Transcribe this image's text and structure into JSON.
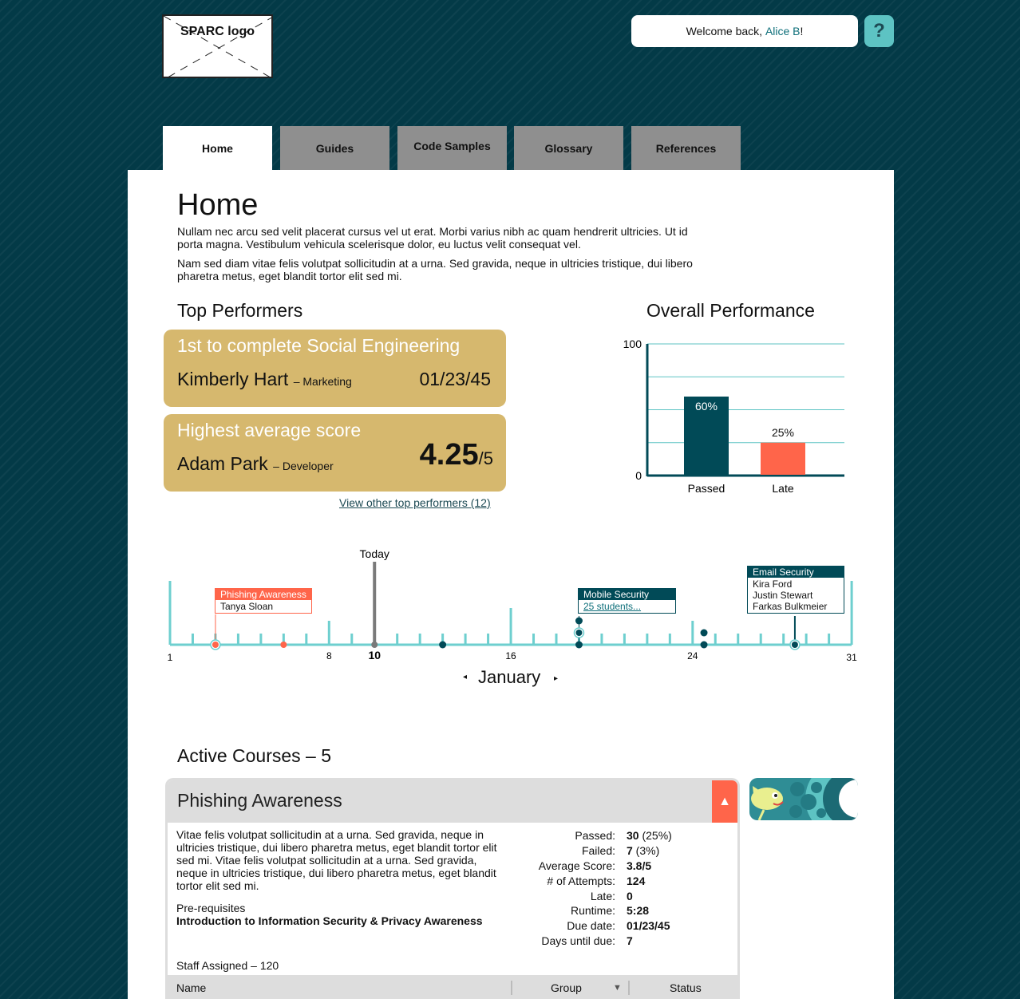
{
  "header": {
    "logo_text": "SPARC logo",
    "welcome_prefix": "Welcome back,",
    "user_name": "Alice B",
    "welcome_suffix": "!",
    "help_label": "?"
  },
  "nav": {
    "tabs": [
      {
        "label": "Home",
        "active": true
      },
      {
        "label": "Guides",
        "active": false
      },
      {
        "label": "Code Samples",
        "active": false
      },
      {
        "label": "Glossary",
        "active": false
      },
      {
        "label": "References",
        "active": false
      }
    ]
  },
  "page": {
    "title": "Home",
    "paragraphs": [
      "Nullam nec arcu sed velit placerat cursus vel ut erat. Morbi varius nibh ac quam hendrerit ultricies. Ut id porta magna. Vestibulum vehicula scelerisque dolor, eu luctus velit consequat vel.",
      "Nam sed diam vitae felis volutpat sollicitudin at a urna. Sed gravida, neque in ultricies tristique, dui libero pharetra metus, eget blandit tortor elit sed mi."
    ]
  },
  "top_performers": {
    "heading": "Top Performers",
    "cards": [
      {
        "title": "1st to complete Social Engineering",
        "name": "Kimberly Hart",
        "dept": "– Marketing",
        "value": "01/23/45"
      },
      {
        "title": "Highest average score",
        "name": "Adam Park",
        "dept": "– Developer",
        "score": "4.25",
        "score_of": "/5"
      }
    ],
    "view_link": "View other top performers (12)"
  },
  "overall_performance": {
    "heading": "Overall Performance"
  },
  "chart_data": {
    "type": "bar",
    "title": "Overall Performance",
    "categories": [
      "Passed",
      "Late"
    ],
    "values": [
      60,
      25
    ],
    "value_labels": [
      "60%",
      "25%"
    ],
    "ylim": [
      0,
      100
    ],
    "yticks": [
      "0",
      "100"
    ],
    "grid": true,
    "colors": [
      "#014a57",
      "#ff654a"
    ]
  },
  "timeline": {
    "today_label": "Today",
    "month": "January",
    "prev_label": "◂",
    "next_label": "▸",
    "day_labels": [
      {
        "day": 1,
        "text": "1"
      },
      {
        "day": 8,
        "text": "8"
      },
      {
        "day": 10,
        "text": "10",
        "bold": true
      },
      {
        "day": 16,
        "text": "16"
      },
      {
        "day": 24,
        "text": "24"
      },
      {
        "day": 31,
        "text": "31"
      }
    ],
    "events": [
      {
        "title": "Phishing Awareness",
        "people": [
          "Tanya Sloan"
        ],
        "color": "#ff654a"
      },
      {
        "title": "Mobile Security",
        "link": "25 students...",
        "color": "#014a57"
      },
      {
        "title": "Email Security",
        "people": [
          "Kira Ford",
          "Justin Stewart",
          "Farkas Bulkmeier"
        ],
        "color": "#014a57"
      }
    ]
  },
  "active_courses": {
    "heading": "Active Courses – 5",
    "course": {
      "title": "Phishing Awareness",
      "collapse_icon": "▲",
      "description": "Vitae felis volutpat sollicitudin at a urna. Sed gravida, neque in ultricies tristique, dui libero pharetra metus, eget blandit tortor elit sed mi. Vitae felis volutpat sollicitudin at a urna. Sed gravida, neque in ultricies tristique, dui libero pharetra metus, eget blandit tortor elit sed mi.",
      "prereq_label": "Pre-requisites",
      "prereq_value": "Introduction to Information Security & Privacy Awareness",
      "stats": [
        {
          "label": "Passed:",
          "value": "30",
          "extra": " (25%)"
        },
        {
          "label": "Failed:",
          "value": "7",
          "extra": " (3%)"
        },
        {
          "label": "Average Score:",
          "value": "3.8/5"
        },
        {
          "label": "# of Attempts:",
          "value": "124"
        },
        {
          "label": "Late:",
          "value": "0"
        }
      ],
      "schedule": [
        {
          "label": "Runtime:",
          "value": "5:28"
        },
        {
          "label": "Due date:",
          "value": "01/23/45"
        },
        {
          "label": "Days until due:",
          "value": "7"
        }
      ],
      "staff_label": "Staff Assigned – 120",
      "columns": [
        "Name",
        "Group",
        "Status"
      ],
      "sort_icon": "▼"
    }
  }
}
